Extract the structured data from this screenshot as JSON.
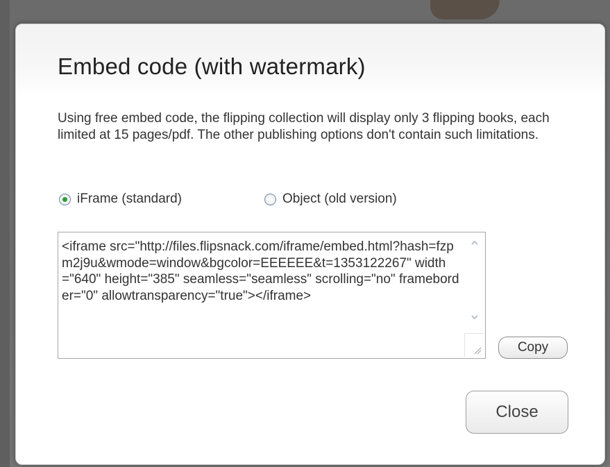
{
  "dialog": {
    "title": "Embed code (with watermark)",
    "description": "Using free embed code, the flipping collection will display only 3 flipping books, each limited at 15 pages/pdf. The other publishing options don't contain such limitations.",
    "radio_options": [
      {
        "label": "iFrame (standard)",
        "selected": true
      },
      {
        "label": "Object (old version)",
        "selected": false
      }
    ],
    "embed_code": "<iframe src=\"http://files.flipsnack.com/iframe/embed.html?hash=fzpm2j9u&wmode=window&bgcolor=EEEEEE&t=1353122267\" width=\"640\" height=\"385\" seamless=\"seamless\" scrolling=\"no\" frameborder=\"0\" allowtransparency=\"true\"></iframe>",
    "copy_label": "Copy",
    "close_label": "Close"
  },
  "icons": {
    "scroll_up": "chevron-up-icon",
    "scroll_down": "chevron-down-icon",
    "resize": "resize-grip-icon"
  },
  "colors": {
    "radio_selected": "#2c9c3a",
    "text": "#333333",
    "title": "#222222"
  }
}
